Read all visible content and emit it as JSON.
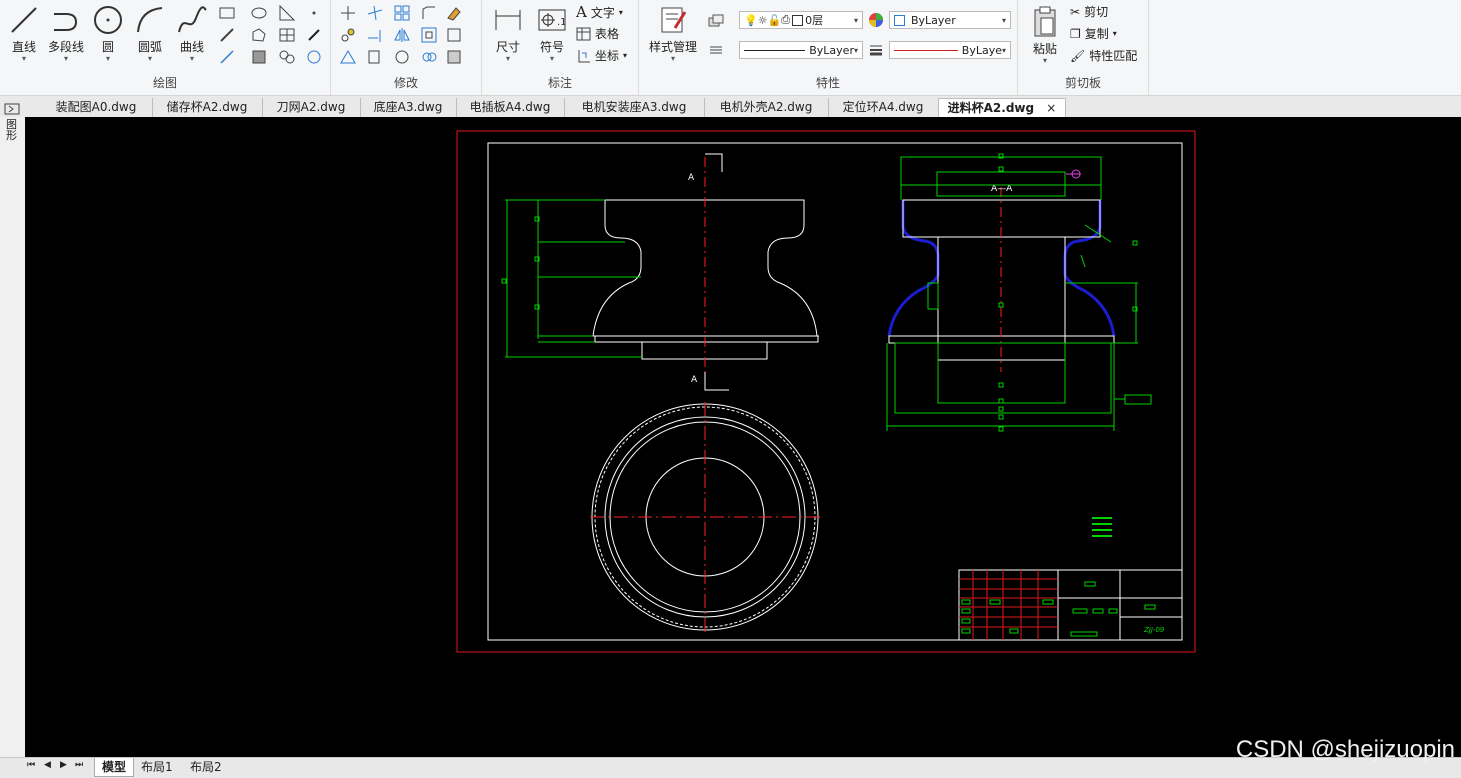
{
  "ribbon": {
    "draw": {
      "label": "绘图",
      "tools": [
        "直线",
        "多段线",
        "圆",
        "圆弧",
        "曲线"
      ]
    },
    "modify": {
      "label": "修改"
    },
    "annotate": {
      "label": "标注",
      "dimension": "尺寸",
      "symbol": "符号",
      "text": "文字",
      "table": "表格",
      "coordinate": "坐标"
    },
    "properties": {
      "label": "特性",
      "style_manager": "样式管理",
      "layer": "0层",
      "color": "ByLayer",
      "linetype": "ByLayer",
      "lineweight": "ByLaye"
    },
    "clipboard": {
      "label": "剪切板",
      "paste": "粘贴",
      "cut": "剪切",
      "copy": "复制",
      "match": "特性匹配"
    }
  },
  "doc_tabs": [
    {
      "label": "装配图A0.dwg"
    },
    {
      "label": "储存杯A2.dwg"
    },
    {
      "label": "刀网A2.dwg"
    },
    {
      "label": "底座A3.dwg"
    },
    {
      "label": "电插板A4.dwg"
    },
    {
      "label": "电机安装座A3.dwg"
    },
    {
      "label": "电机外壳A2.dwg"
    },
    {
      "label": "定位环A4.dwg"
    },
    {
      "label": "进料杯A2.dwg",
      "active": true
    }
  ],
  "close_glyph": "×",
  "sidebar_label": "图形",
  "drawing": {
    "section_label_top": "A",
    "section_label_bottom": "A",
    "section_title": "A—A",
    "part_no": "ZJJ-09"
  },
  "layout_tabs": [
    "模型",
    "布局1",
    "布局2"
  ],
  "watermark": "CSDN @shejizuopin",
  "colors": {
    "canvas": "#000000",
    "border_red": "#e0161c",
    "dim_green": "#00d400",
    "outline_white": "#ffffff",
    "center_red": "#ff2020",
    "highlight_blue": "#1c1cd0"
  }
}
